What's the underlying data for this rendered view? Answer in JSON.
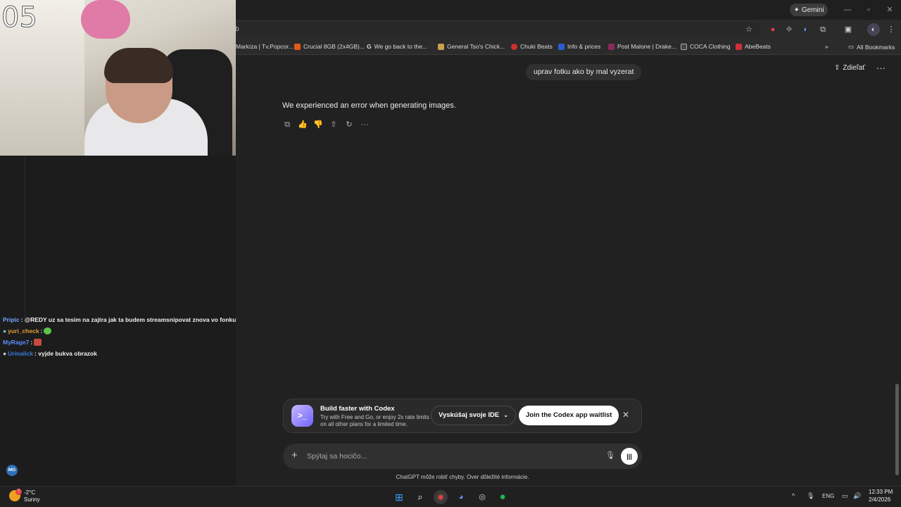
{
  "browser": {
    "gemini_label": "Gemini",
    "url_fragment": "b",
    "bookmarks": [
      {
        "label": "Markíza | Tv.Popcor...",
        "color": "#3a3a3a"
      },
      {
        "label": "Crucial 8GB (2x4GB)...",
        "color": "#e25a1c"
      },
      {
        "label": "We go back to the...",
        "color": "#4a4a4a"
      },
      {
        "label": "General Tso's Chick...",
        "color": "#c9a050"
      },
      {
        "label": "Chuki Beats",
        "color": "#d0302a"
      },
      {
        "label": "Info & prices",
        "color": "#2a5bd0"
      },
      {
        "label": "Post Malone | Drake...",
        "color": "#8a2a5a"
      },
      {
        "label": "COCA Clothing",
        "color": "#444444"
      },
      {
        "label": "AbeBeats",
        "color": "#d0303a"
      }
    ],
    "all_bookmarks": "All Bookmarks"
  },
  "webcam": {
    "overlay_number": "05"
  },
  "chat": [
    {
      "user": "Pripic",
      "message": ": @REDY uz sa tesim na zajtra jak ta budem streamsnipovat znova vo fonku",
      "emote": null
    },
    {
      "user": "yuri_check",
      "message": ":",
      "emote": "#5cc44a"
    },
    {
      "user": "MyRage7",
      "message": ":",
      "emote": "#c84a3a"
    },
    {
      "user": "Urinalick",
      "message": ": vyjde bukva obrazok",
      "emote": null
    }
  ],
  "avatar_initials": "MG",
  "conversation": {
    "share_label": "Zdieľať",
    "user_message": "uprav fotku ako by mal vyzerat",
    "assistant_message": "We experienced an error when generating images."
  },
  "codex_banner": {
    "title": "Build faster with Codex",
    "description": "Try with Free and Go, or enjoy 2x rate limits on all other plans for a limited time.",
    "try_label": "Vyskúšaj svoje IDE",
    "join_label": "Join the Codex app waitlist"
  },
  "composer": {
    "placeholder": "Spýtaj sa hocičo...",
    "disclaimer": "ChatGPT môže robiť chyby. Over dôležité informácie."
  },
  "taskbar": {
    "weather_temp": "-2°C",
    "weather_desc": "Sunny",
    "weather_badge": "7",
    "lang": "ENG",
    "time": "12:33 PM",
    "date": "2/4/2026"
  }
}
